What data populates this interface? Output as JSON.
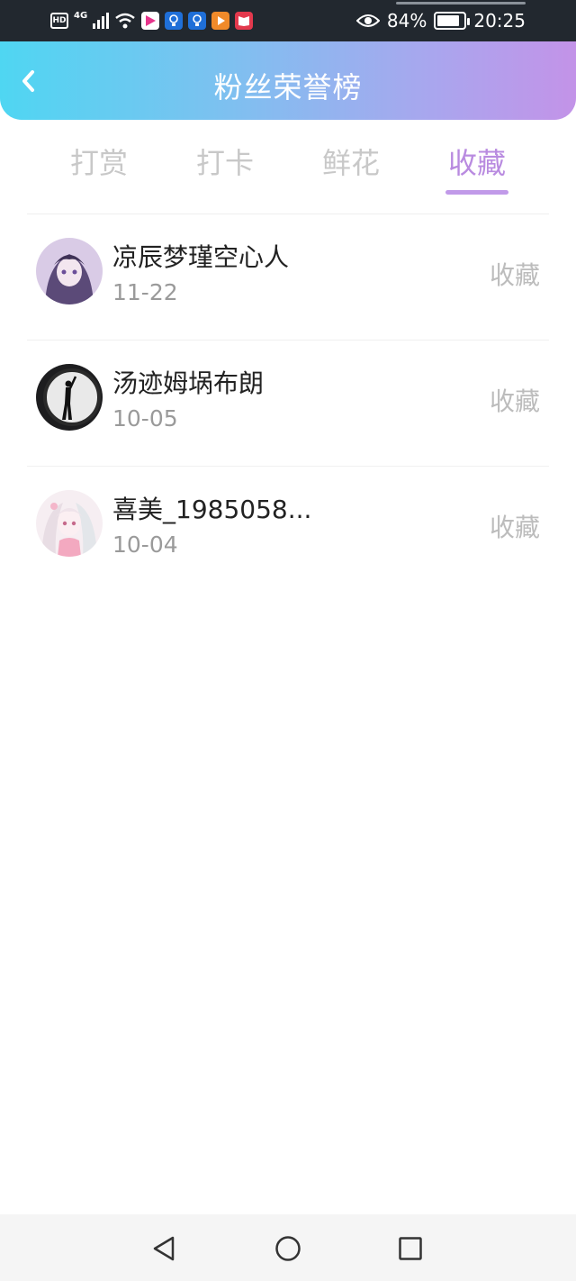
{
  "status_bar": {
    "hd": "HD",
    "network": "4G",
    "battery": "84%",
    "time": "20:25",
    "icons": [
      "wifi-icon",
      "video-app-icon",
      "bulb-app-icon",
      "bulb-app-icon",
      "play-app-icon",
      "book-app-icon",
      "eye-icon",
      "battery-icon"
    ]
  },
  "header": {
    "title": "粉丝荣誉榜"
  },
  "tabs": [
    {
      "label": "打赏",
      "active": false
    },
    {
      "label": "打卡",
      "active": false
    },
    {
      "label": "鲜花",
      "active": false
    },
    {
      "label": "收藏",
      "active": true
    }
  ],
  "rows": [
    {
      "name": "凉辰梦瑾空心人",
      "date": "11-22",
      "type": "收藏",
      "avatar": "avatar-anime-purple"
    },
    {
      "name": "汤迹姆埚布朗",
      "date": "10-05",
      "type": "收藏",
      "avatar": "avatar-silhouette"
    },
    {
      "name": "喜美_1985058...",
      "date": "10-04",
      "type": "收藏",
      "avatar": "avatar-anime-pink"
    }
  ],
  "colors": {
    "header_start": "#4fd6f2",
    "header_end": "#c393e8",
    "tab_active": "#b98be0",
    "tab_inactive": "#c8c8c8"
  }
}
